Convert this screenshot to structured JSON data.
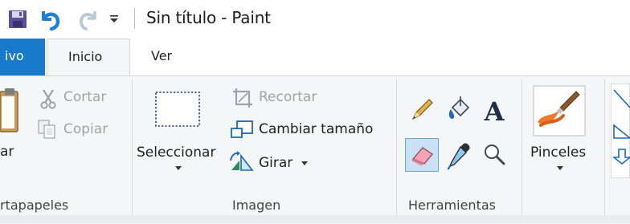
{
  "window": {
    "title": "Sin título - Paint"
  },
  "quick_access": {
    "icons": [
      "save-icon",
      "undo-icon",
      "redo-icon",
      "customize-dropdown-icon"
    ]
  },
  "tabs": [
    {
      "label": "ivo",
      "active_style": "file"
    },
    {
      "label": "Inicio",
      "selected": true
    },
    {
      "label": "Ver"
    }
  ],
  "ribbon": {
    "portapapeles": {
      "label": "rtapapeles",
      "paste_label": "ar",
      "cut_label": "Cortar",
      "copy_label": "Copiar"
    },
    "imagen": {
      "label": "Imagen",
      "select_label": "Seleccionar",
      "crop_label": "Recortar",
      "resize_label": "Cambiar tamaño",
      "rotate_label": "Girar"
    },
    "herramientas": {
      "label": "Herramientas",
      "tools": [
        "pencil-icon",
        "fill-icon",
        "text-icon",
        "eraser-icon",
        "color-picker-icon",
        "magnifier-icon"
      ]
    },
    "pinceles": {
      "label": "Pinceles"
    }
  },
  "colors": {
    "file_tab": "#1979ca",
    "ribbon_bg": "#f5f6f7",
    "selected_tool_bg": "#c9e0f7",
    "selected_tool_border": "#6ea6dc"
  }
}
